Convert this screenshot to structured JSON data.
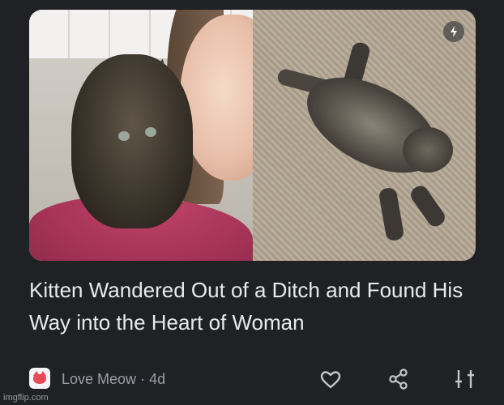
{
  "article": {
    "headline": "Kitten Wandered Out of a Ditch and Found His Way into the Heart of Woman",
    "source": "Love Meow",
    "age": "4d",
    "separator": "·",
    "image_left_icon": "woman-holding-kitten-photo",
    "image_right_icon": "kitten-on-carpet-photo",
    "badge_icon": "amp-lightning-icon"
  },
  "actions": {
    "like_icon": "heart-outline-icon",
    "share_icon": "share-icon",
    "tune_icon": "tune-sliders-icon"
  },
  "watermark": "imgflip.com",
  "colors": {
    "background": "#202124",
    "headline": "#e8eaed",
    "meta": "#9aa0a6",
    "icon": "#c4c7c5",
    "source_logo": "#e94b5b"
  }
}
